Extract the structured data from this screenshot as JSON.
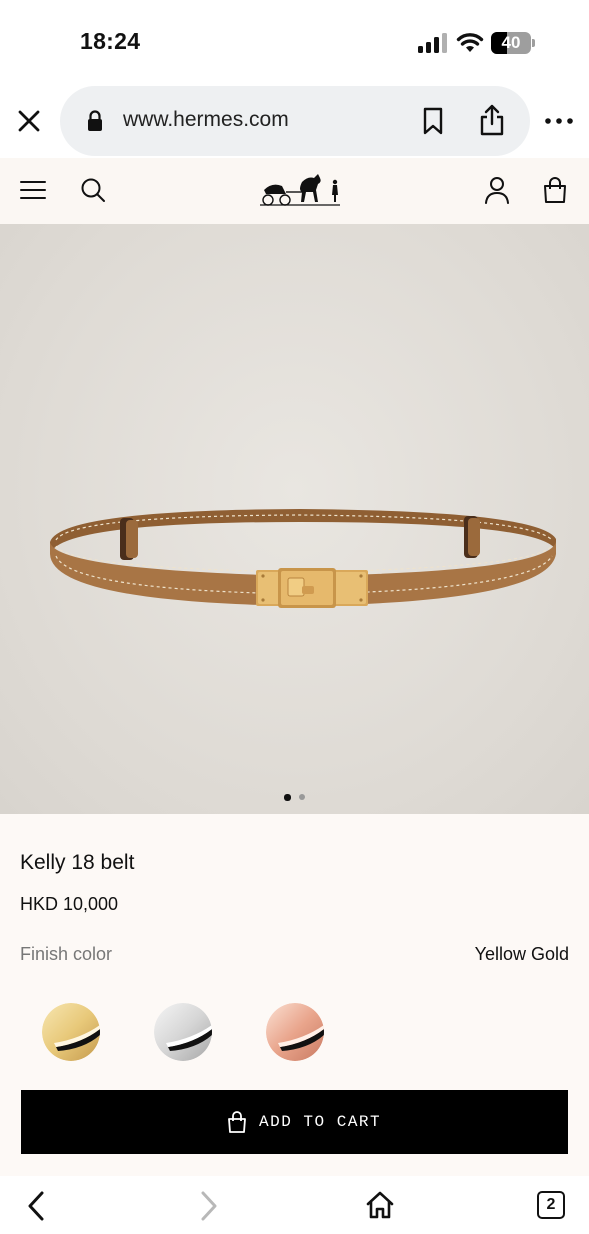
{
  "status_bar": {
    "time": "18:24",
    "battery_level": "40"
  },
  "browser": {
    "url": "www.hermes.com",
    "open_tabs": "2"
  },
  "product": {
    "name": "Kelly 18 belt",
    "price": "HKD 10,000",
    "finish_label": "Finish color",
    "finish_value": "Yellow Gold",
    "image_count": 2,
    "active_image": 1,
    "swatches": [
      {
        "name": "Yellow Gold",
        "color": "#e8c97a",
        "selected": true
      },
      {
        "name": "Silver",
        "color": "#c9c9c9",
        "selected": false
      },
      {
        "name": "Rose Gold",
        "color": "#e9a58c",
        "selected": false
      }
    ],
    "add_to_cart_label": "ADD TO CART"
  },
  "colors": {
    "header_bg": "#fbf7f3",
    "info_bg": "#fdf9f6",
    "image_bg": "#e1ddd7",
    "belt_leather": "#a87545",
    "buckle_gold": "#d9a85a",
    "cta_bg": "#000000"
  },
  "icons": {
    "close": "close-icon",
    "lock": "lock-icon",
    "bookmark": "bookmark-icon",
    "share": "share-icon",
    "more": "more-icon",
    "menu": "menu-icon",
    "search": "search-icon",
    "account": "account-icon",
    "bag": "bag-icon",
    "back": "chevron-left-icon",
    "forward": "chevron-right-icon",
    "home": "home-icon"
  }
}
